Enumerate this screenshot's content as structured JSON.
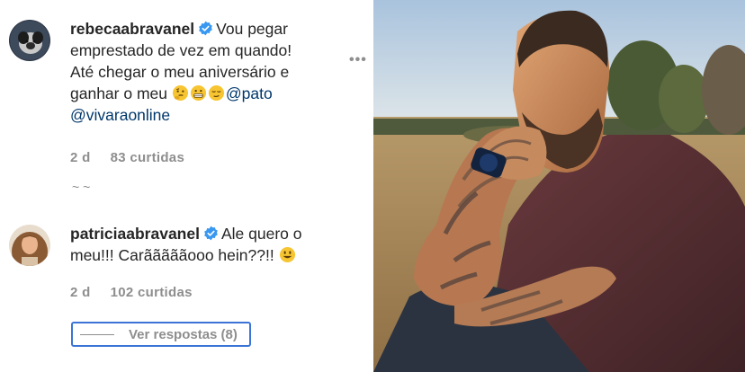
{
  "comments": [
    {
      "username": "rebecaabravanel",
      "text_line1": "Vou pegar",
      "text_line2": "emprestado de vez em quando!",
      "text_line3": "Até chegar o meu aniversário e",
      "text_line4_prefix": "ganhar o meu",
      "mention1": "@pato",
      "mention2": "@vivaraonline",
      "time": "2 d",
      "likes": "83 curtidas"
    },
    {
      "username": "patriciaabravanel",
      "text_line1": "Ale quero o",
      "text_line2": "meu!!! Carãããããooo hein??!!",
      "time": "2 d",
      "likes": "102 curtidas"
    }
  ],
  "separator": "~ ~",
  "more_options": "•••",
  "view_replies": "Ver respostas (8)",
  "colors": {
    "verified_blue": "#3897f0",
    "mention": "#00376b",
    "meta_gray": "#8e8e8e",
    "highlight_border": "#3b74d6"
  }
}
